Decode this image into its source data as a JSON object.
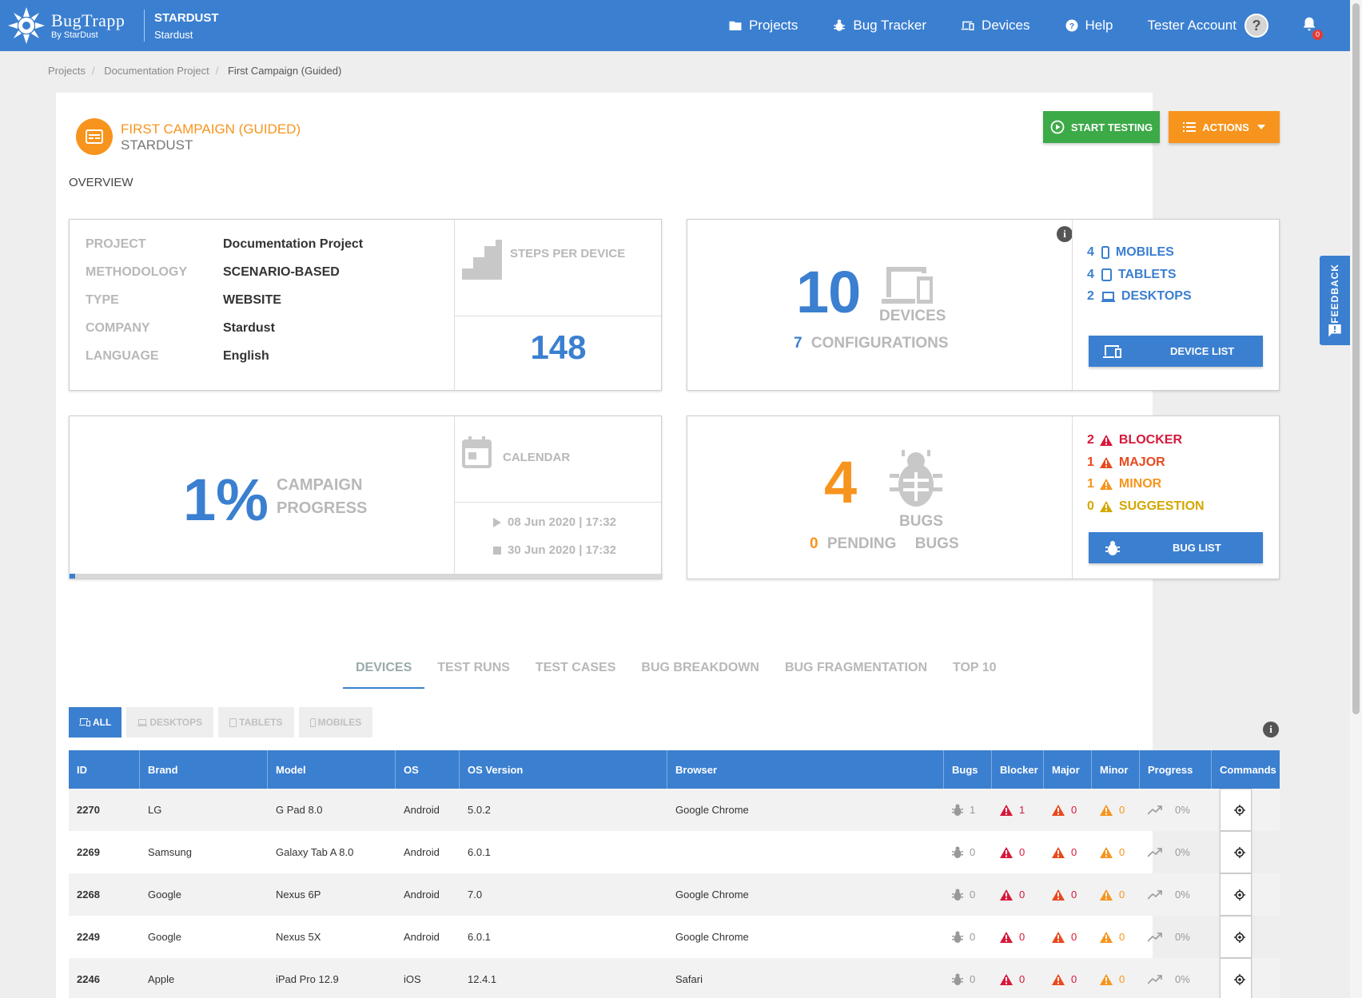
{
  "app": {
    "logo_name": "BugTrapp",
    "logo_sub": "By StarDust",
    "org_title": "STARDUST",
    "org_sub": "Stardust"
  },
  "nav": {
    "projects": "Projects",
    "bug_tracker": "Bug Tracker",
    "devices": "Devices",
    "help": "Help",
    "account": "Tester Account",
    "notifications_count": "0"
  },
  "breadcrumb": [
    "Projects",
    "Documentation Project",
    "First Campaign (Guided)"
  ],
  "campaign": {
    "title": "FIRST CAMPAIGN (GUIDED)",
    "subtitle": "STARDUST",
    "start_label": "START TESTING",
    "actions_label": "ACTIONS",
    "overview_label": "OVERVIEW"
  },
  "info": {
    "rows": [
      {
        "k": "PROJECT",
        "v": "Documentation Project"
      },
      {
        "k": "METHODOLOGY",
        "v": "SCENARIO-BASED"
      },
      {
        "k": "TYPE",
        "v": "WEBSITE"
      },
      {
        "k": "COMPANY",
        "v": "Stardust"
      },
      {
        "k": "LANGUAGE",
        "v": "English"
      }
    ],
    "steps_label": "STEPS PER DEVICE",
    "steps_value": "148"
  },
  "devices": {
    "count": "10",
    "label": "DEVICES",
    "configs": "7",
    "configs_label": "CONFIGURATIONS",
    "mobiles": "4",
    "mobiles_label": "MOBILES",
    "tablets": "4",
    "tablets_label": "TABLETS",
    "desktops": "2",
    "desktops_label": "DESKTOPS",
    "list_button": "DEVICE LIST"
  },
  "progress": {
    "value": "1%",
    "label1": "CAMPAIGN",
    "label2": "PROGRESS",
    "fraction": 0.01,
    "calendar_label": "CALENDAR",
    "start": "08 Jun 2020 | 17:32",
    "end": "30 Jun 2020 | 17:32"
  },
  "bugs": {
    "count": "4",
    "label": "BUGS",
    "pending": "0",
    "pending_label": "PENDING",
    "pending_bugs": "BUGS",
    "blocker": "2",
    "blocker_label": "BLOCKER",
    "major": "1",
    "major_label": "MAJOR",
    "minor": "1",
    "minor_label": "MINOR",
    "suggestion": "0",
    "suggestion_label": "SUGGESTION",
    "list_button": "BUG LIST"
  },
  "tabs": [
    "DEVICES",
    "TEST RUNS",
    "TEST CASES",
    "BUG BREAKDOWN",
    "BUG FRAGMENTATION",
    "TOP 10"
  ],
  "filters": [
    "ALL",
    "DESKTOPS",
    "TABLETS",
    "MOBILES"
  ],
  "table": {
    "headers": [
      "ID",
      "Brand",
      "Model",
      "OS",
      "OS Version",
      "Browser",
      "Bugs",
      "Blocker",
      "Major",
      "Minor",
      "Progress",
      "Commands"
    ],
    "rows": [
      {
        "id": "2270",
        "brand": "LG",
        "model": "G Pad 8.0",
        "os": "Android",
        "osv": "5.0.2",
        "browser": "Google Chrome",
        "bugs": "1",
        "blocker": "1",
        "major": "0",
        "minor": "0",
        "progress": "0%"
      },
      {
        "id": "2269",
        "brand": "Samsung",
        "model": "Galaxy Tab A 8.0",
        "os": "Android",
        "osv": "6.0.1",
        "browser": "",
        "bugs": "0",
        "blocker": "0",
        "major": "0",
        "minor": "0",
        "progress": "0%"
      },
      {
        "id": "2268",
        "brand": "Google",
        "model": "Nexus 6P",
        "os": "Android",
        "osv": "7.0",
        "browser": "Google Chrome",
        "bugs": "0",
        "blocker": "0",
        "major": "0",
        "minor": "0",
        "progress": "0%"
      },
      {
        "id": "2249",
        "brand": "Google",
        "model": "Nexus 5X",
        "os": "Android",
        "osv": "6.0.1",
        "browser": "Google Chrome",
        "bugs": "0",
        "blocker": "0",
        "major": "0",
        "minor": "0",
        "progress": "0%"
      },
      {
        "id": "2246",
        "brand": "Apple",
        "model": "iPad Pro 12.9",
        "os": "iOS",
        "osv": "12.4.1",
        "browser": "Safari",
        "bugs": "0",
        "blocker": "0",
        "major": "0",
        "minor": "0",
        "progress": "0%"
      }
    ]
  },
  "feedback_label": "FEEDBACK",
  "colors": {
    "primary": "#3b7fd0",
    "accent": "#f7941d",
    "success": "#3daa48",
    "blocker": "#d6183b",
    "major": "#e8491d",
    "minor": "#f7941d",
    "suggestion": "#d4a700"
  }
}
